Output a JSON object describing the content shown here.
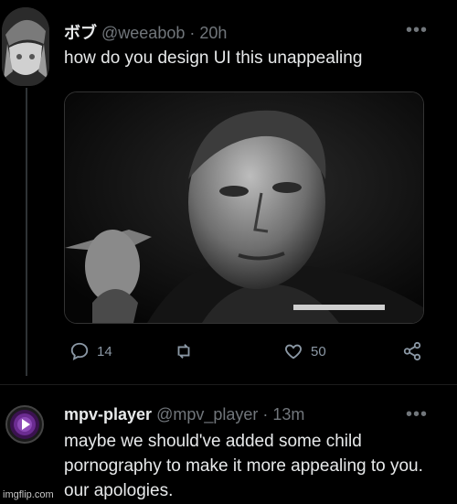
{
  "tweet1": {
    "display_name": "ボブ",
    "handle_time": "@weeabob · 20h",
    "text": "how do you design UI this unappealing",
    "more_icon": "more-horizontal-icon",
    "actions": {
      "reply_count": "14",
      "retweet_count": "",
      "like_count": "50"
    }
  },
  "tweet2": {
    "display_name": "mpv-player",
    "handle_time": "@mpv_player · 13m",
    "text": "maybe we should've added some child pornography to make it more appealing to you. our apologies.",
    "more_icon": "more-horizontal-icon"
  },
  "watermark": "imgflip.com",
  "colors": {
    "background": "#000000",
    "text": "#e7e9ea",
    "secondary_text": "#71767b",
    "mpv_purple": "#6b2c91"
  }
}
